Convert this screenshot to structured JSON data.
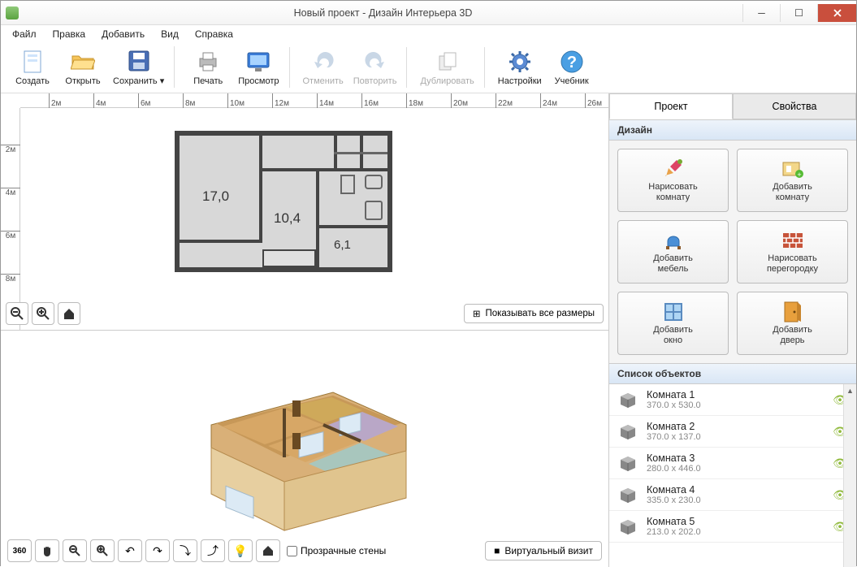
{
  "window": {
    "title": "Новый проект - Дизайн Интерьера 3D"
  },
  "menu": [
    "Файл",
    "Правка",
    "Добавить",
    "Вид",
    "Справка"
  ],
  "toolbar": [
    {
      "id": "create",
      "label": "Создать",
      "icon": "file"
    },
    {
      "id": "open",
      "label": "Открыть",
      "icon": "folder"
    },
    {
      "id": "save",
      "label": "Сохранить",
      "icon": "disk",
      "dropdown": true
    },
    {
      "sep": true
    },
    {
      "id": "print",
      "label": "Печать",
      "icon": "printer"
    },
    {
      "id": "preview",
      "label": "Просмотр",
      "icon": "monitor"
    },
    {
      "sep": true
    },
    {
      "id": "undo",
      "label": "Отменить",
      "icon": "undo",
      "disabled": true
    },
    {
      "id": "redo",
      "label": "Повторить",
      "icon": "redo",
      "disabled": true
    },
    {
      "sep": true
    },
    {
      "id": "duplicate",
      "label": "Дублировать",
      "icon": "copy",
      "disabled": true
    },
    {
      "sep": true
    },
    {
      "id": "settings",
      "label": "Настройки",
      "icon": "gear"
    },
    {
      "id": "help",
      "label": "Учебник",
      "icon": "help"
    }
  ],
  "ruler_h": [
    "2м",
    "4м",
    "6м",
    "8м",
    "10м",
    "12м",
    "14м",
    "16м",
    "18м",
    "20м",
    "22м",
    "24м",
    "26м"
  ],
  "ruler_v": [
    "2м",
    "4м",
    "6м",
    "8м"
  ],
  "rooms_labels": {
    "r1": "17,0",
    "r2": "10,4",
    "r3": "6,1"
  },
  "show_dims_label": "Показывать все размеры",
  "transparent_walls_label": "Прозрачные стены",
  "virtual_visit_label": "Виртуальный визит",
  "tabs": {
    "project": "Проект",
    "props": "Свойства"
  },
  "sections": {
    "design": "Дизайн",
    "objects": "Список объектов"
  },
  "design_buttons": [
    {
      "id": "draw-room",
      "l1": "Нарисовать",
      "l2": "комнату",
      "icon": "pencil"
    },
    {
      "id": "add-room",
      "l1": "Добавить",
      "l2": "комнату",
      "icon": "room"
    },
    {
      "id": "add-furniture",
      "l1": "Добавить",
      "l2": "мебель",
      "icon": "chair"
    },
    {
      "id": "draw-partition",
      "l1": "Нарисовать",
      "l2": "перегородку",
      "icon": "wall"
    },
    {
      "id": "add-window",
      "l1": "Добавить",
      "l2": "окно",
      "icon": "window"
    },
    {
      "id": "add-door",
      "l1": "Добавить",
      "l2": "дверь",
      "icon": "door"
    }
  ],
  "objects": [
    {
      "name": "Комната 1",
      "dims": "370.0 x 530.0"
    },
    {
      "name": "Комната 2",
      "dims": "370.0 x 137.0"
    },
    {
      "name": "Комната 3",
      "dims": "280.0 x 446.0"
    },
    {
      "name": "Комната 4",
      "dims": "335.0 x 230.0"
    },
    {
      "name": "Комната 5",
      "dims": "213.0 x 202.0"
    }
  ]
}
